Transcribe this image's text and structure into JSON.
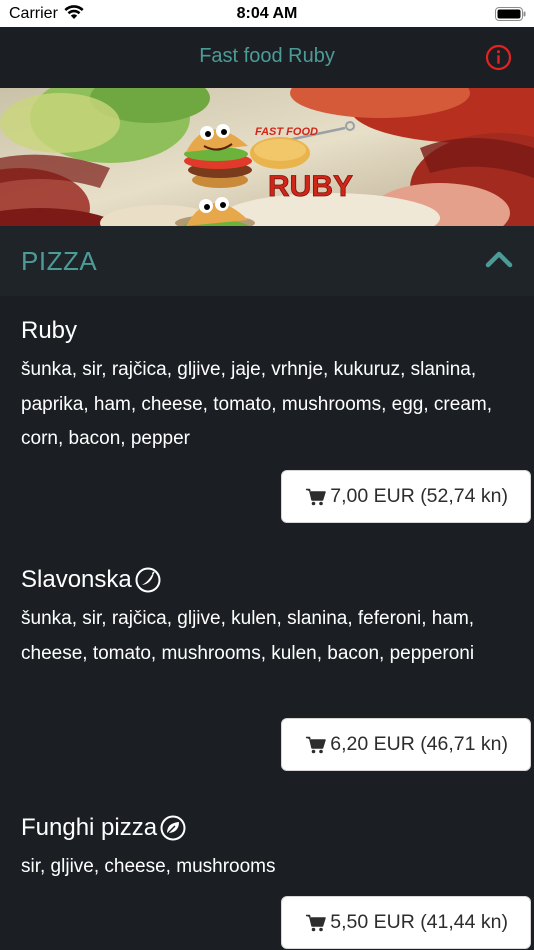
{
  "status_bar": {
    "carrier": "Carrier",
    "time": "8:04 AM"
  },
  "nav": {
    "title": "Fast food Ruby"
  },
  "banner": {
    "logo_small": "FAST FOOD",
    "logo_main": "RUBY"
  },
  "section": {
    "title": "PIZZA"
  },
  "items": [
    {
      "name": "Ruby",
      "desc": "šunka, sir, rajčica, gljive, jaje, vrhnje, kukuruz, slanina, paprika, ham, cheese, tomato, mushrooms, egg, cream, corn, bacon, pepper",
      "price": "7,00 EUR (52,74 kn)"
    },
    {
      "name": "Slavonska",
      "desc": "šunka, sir, rajčica, gljive, kulen, slanina, feferoni, ham, cheese, tomato, mushrooms, kulen, bacon, pepperoni",
      "price": "6,20 EUR (46,71 kn)",
      "icon": "chili-icon"
    },
    {
      "name": "Funghi pizza",
      "desc": "sir, gljive, cheese, mushrooms",
      "price": "5,50 EUR (41,44 kn)",
      "icon": "leaf-icon"
    }
  ],
  "colors": {
    "accent": "#4b9c98",
    "info": "#e02424",
    "background": "#1b1f23"
  }
}
